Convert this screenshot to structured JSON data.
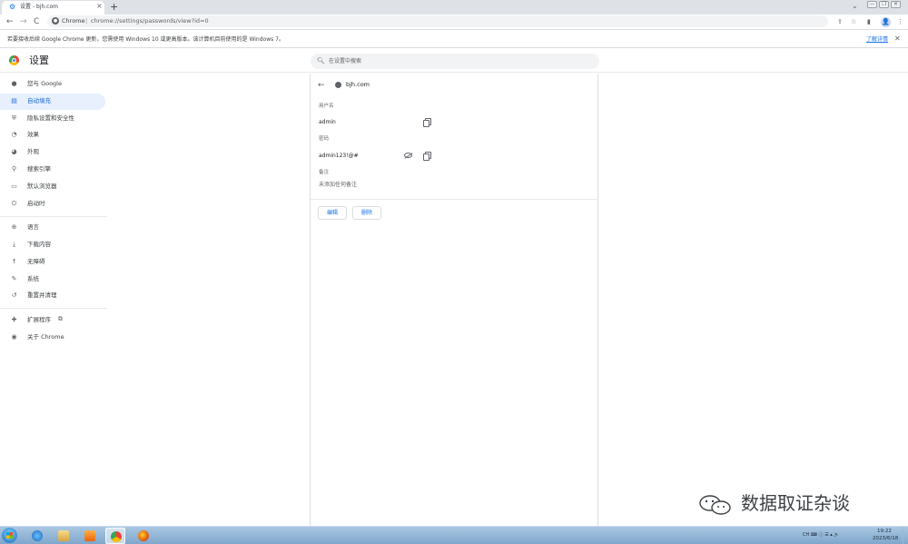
{
  "browser": {
    "tab_title": "设置 - bjh.com",
    "tab_close": "×",
    "new_tab": "+",
    "tab_search": "⌄",
    "window_controls": [
      "—",
      "❐",
      "✕"
    ],
    "nav_back": "←",
    "nav_forward": "→",
    "reload": "C",
    "url_chip": "Chrome",
    "url_separator": "|",
    "url": "chrome://settings/passwords/view?id=0",
    "toolbar_icons": [
      "share-icon",
      "star-icon",
      "side-panel-icon",
      "profile-icon",
      "menu-icon"
    ]
  },
  "infobar": {
    "message": "若要接收后续 Google Chrome 更新，您需使用 Windows 10 或更高版本。该计算机目前使用的是 Windows 7。",
    "link": "了解详情",
    "close": "✕"
  },
  "header": {
    "title": "设置",
    "search_placeholder": "在设置中搜索"
  },
  "sidebar": {
    "items": [
      {
        "label": "您与 Google",
        "icon": "person-icon",
        "active": false
      },
      {
        "label": "自动填充",
        "icon": "autofill-icon",
        "active": true
      },
      {
        "label": "隐私设置和安全性",
        "icon": "shield-icon",
        "active": false
      },
      {
        "label": "效果",
        "icon": "speedometer-icon",
        "active": false
      },
      {
        "label": "外观",
        "icon": "palette-icon",
        "active": false
      },
      {
        "label": "搜索引擎",
        "icon": "search-icon",
        "active": false
      },
      {
        "label": "默认浏览器",
        "icon": "browser-icon",
        "active": false
      },
      {
        "label": "启动时",
        "icon": "power-icon",
        "active": false
      },
      {
        "label": "语言",
        "icon": "globe-icon",
        "active": false
      },
      {
        "label": "下载内容",
        "icon": "download-icon",
        "active": false
      },
      {
        "label": "无障碍",
        "icon": "accessibility-icon",
        "active": false
      },
      {
        "label": "系统",
        "icon": "wrench-icon",
        "active": false
      },
      {
        "label": "重置并清理",
        "icon": "history-icon",
        "active": false
      },
      {
        "label": "扩展程序",
        "icon": "puzzle-icon",
        "active": false
      },
      {
        "label": "关于 Chrome",
        "icon": "chrome-icon",
        "active": false
      }
    ]
  },
  "password_detail": {
    "site": "bjh.com",
    "username_label": "用户名",
    "username": "admin",
    "password_label": "密码",
    "password": "admin123!@#",
    "note_label": "备注",
    "note": "未添加任何备注",
    "edit_button": "编辑",
    "delete_button": "删除"
  },
  "watermark": {
    "text": "数据取证杂谈"
  },
  "taskbar": {
    "apps": [
      "ie-icon",
      "explorer-icon",
      "media-player-icon",
      "chrome-icon",
      "firefox-icon"
    ],
    "tray": "CH ⌨ ⓘ ☰ ▴ 🔈",
    "time": "19:22",
    "date": "2023/6/18"
  }
}
